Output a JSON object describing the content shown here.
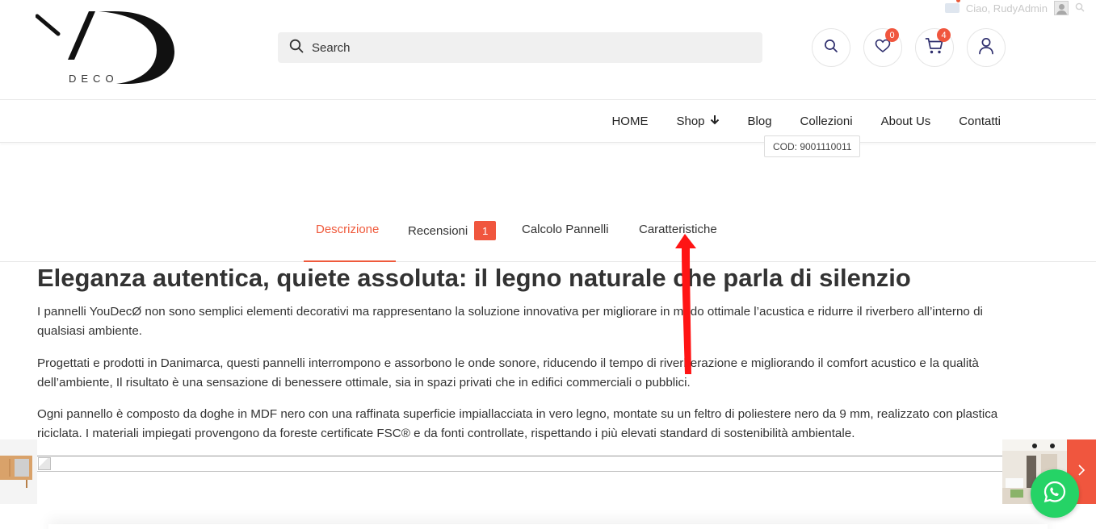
{
  "admin_bar": {
    "greeting": "Ciao, RudyAdmin"
  },
  "header": {
    "logo_text": "DECO",
    "search_placeholder": "Search",
    "wishlist_count": "0",
    "cart_count": "4"
  },
  "nav": {
    "items": [
      {
        "label": "HOME"
      },
      {
        "label": "Shop"
      },
      {
        "label": "Blog"
      },
      {
        "label": "Collezioni"
      },
      {
        "label": "About Us"
      },
      {
        "label": "Contatti"
      }
    ]
  },
  "product": {
    "cod": "COD: 9001110011"
  },
  "tabs": {
    "items": [
      {
        "label": "Descrizione"
      },
      {
        "label": "Recensioni",
        "count": "1"
      },
      {
        "label": "Calcolo Pannelli"
      },
      {
        "label": "Caratteristiche"
      }
    ]
  },
  "content": {
    "heading": "Eleganza autentica, quiete assoluta: il legno naturale che parla di silenzio",
    "paragraphs": [
      "I pannelli YouDecØ non sono semplici elementi decorativi ma rappresentano la soluzione innovativa per migliorare in modo ottimale l’acustica e ridurre il riverbero all’interno di qualsiasi ambiente.",
      "Progettati e prodotti in Danimarca, questi pannelli interrompono e assorbono le onde sonore, riducendo il tempo di riverberazione e migliorando il comfort acustico e la qualità dell’ambiente, Il risultato è una sensazione di benessere ottimale, sia in spazi privati che in edifici commerciali o pubblici.",
      "Ogni pannello è composto da doghe in MDF nero con una raffinata superficie impiallacciata in vero legno, montate su un feltro di poliestere nero da 9 mm, realizzato con plastica riciclata. I materiali impiegati provengono da foreste certificate FSC® e da fonti controllate, rispettando i più elevati standard di sostenibilità ambientale."
    ]
  },
  "colors": {
    "accent": "#ef5a3c",
    "whatsapp": "#25d366"
  }
}
